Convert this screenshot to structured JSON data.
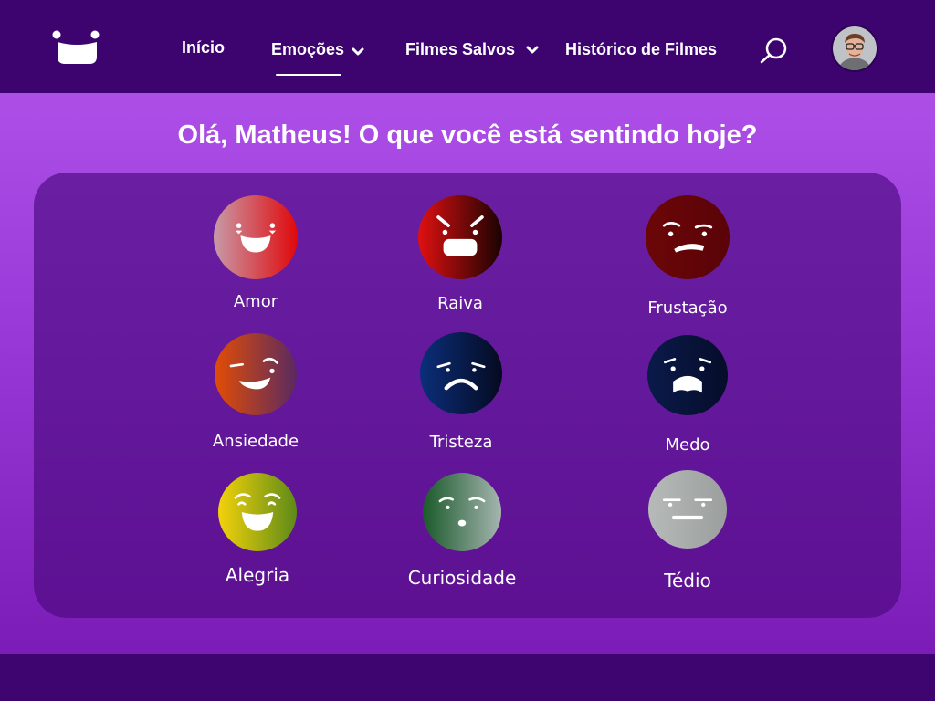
{
  "header": {
    "logo_icon": "smile-logo-icon",
    "nav": [
      {
        "label": "Início",
        "active": false
      },
      {
        "label": "Emoções",
        "active": true,
        "dropdown": true
      },
      {
        "label": "Filmes Salvos",
        "active": false,
        "dropdown": true
      },
      {
        "label": "Histórico de Filmes",
        "active": false
      }
    ],
    "search_icon": "search-icon",
    "avatar": "user-avatar"
  },
  "greeting": "Olá, Matheus! O que você está sentindo hoje?",
  "emotions": [
    {
      "label": "Amor",
      "colors": [
        "#c89aa8",
        "#e0080a"
      ]
    },
    {
      "label": "Raiva",
      "colors": [
        "#e01010",
        "#1a0202"
      ]
    },
    {
      "label": "Frustação",
      "colors": [
        "#6b0608",
        "#5a0308"
      ]
    },
    {
      "label": "Ansiedade",
      "colors": [
        "#e24c05",
        "#5a2a60"
      ]
    },
    {
      "label": "Tristeza",
      "colors": [
        "#0b2e7a",
        "#050a20"
      ]
    },
    {
      "label": "Medo",
      "colors": [
        "#0a1a4a",
        "#060d2a"
      ]
    },
    {
      "label": "Alegria",
      "colors": [
        "#f3d20a",
        "#5e8a18"
      ]
    },
    {
      "label": "Curiosidade",
      "colors": [
        "#1a5a2a",
        "#a5b5b0"
      ]
    },
    {
      "label": "Tédio",
      "colors": [
        "#b6bab8",
        "#9a9e9c"
      ]
    }
  ],
  "colors": {
    "header_bg": "#3d046f",
    "page_gradient_top": "#ad4fe7",
    "panel": "#5d1092"
  }
}
